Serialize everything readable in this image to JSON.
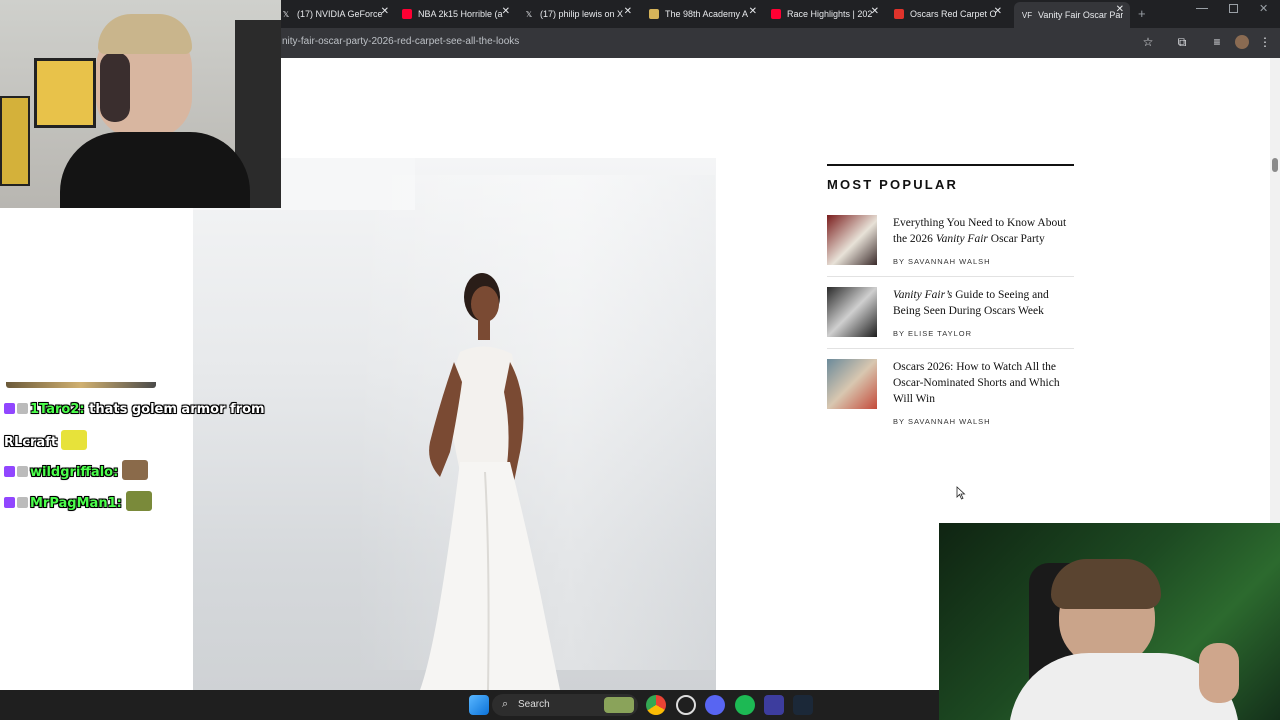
{
  "browser": {
    "tabs": [
      {
        "title": "(17) NVIDIA GeForce",
        "icon": "x-logo-icon",
        "color": "#ffffff"
      },
      {
        "title": "NBA 2k15 Horrible (a",
        "icon": "youtube-icon",
        "color": "#ff0033"
      },
      {
        "title": "(17) philip lewis on X",
        "icon": "x-logo-icon",
        "color": "#ffffff"
      },
      {
        "title": "The 98th Academy A",
        "icon": "academy-icon",
        "color": "#d6b45a"
      },
      {
        "title": "Race Highlights | 202",
        "icon": "youtube-icon",
        "color": "#ff0033"
      },
      {
        "title": "Oscars Red Carpet O",
        "icon": "site-icon",
        "color": "#e0332b"
      },
      {
        "title": "Vanity Fair Oscar Par",
        "icon": "vf-icon",
        "color": "#ffffff"
      }
    ],
    "url": "nity-fair-oscar-party-2026-red-carpet-see-all-the-looks"
  },
  "page": {
    "most_popular_title": "MOST POPULAR",
    "items": [
      {
        "headline_pre": "Everything You Need to Know About the 2026 ",
        "headline_italic": "Vanity Fair",
        "headline_post": " Oscar Party",
        "byline": "BY SAVANNAH WALSH"
      },
      {
        "headline_pre": "",
        "headline_italic": "Vanity Fair’s",
        "headline_post": " Guide to Seeing and Being Seen During Oscars Week",
        "byline": "BY ELISE TAYLOR"
      },
      {
        "headline_pre": "Oscars 2026: How to Watch All the Oscar-Nominated Shorts and Which Will Win",
        "headline_italic": "",
        "headline_post": "",
        "byline": "BY SAVANNAH WALSH"
      }
    ]
  },
  "chat": {
    "lines": [
      {
        "name": "1Taro2:",
        "message": " thats golem armor from"
      },
      {
        "name": "",
        "message": "RLcraft"
      },
      {
        "name": "wildgriffalo:",
        "message": ""
      },
      {
        "name": "MrPagMan1:",
        "message": ""
      }
    ]
  },
  "taskbar": {
    "search_label": "Search"
  }
}
